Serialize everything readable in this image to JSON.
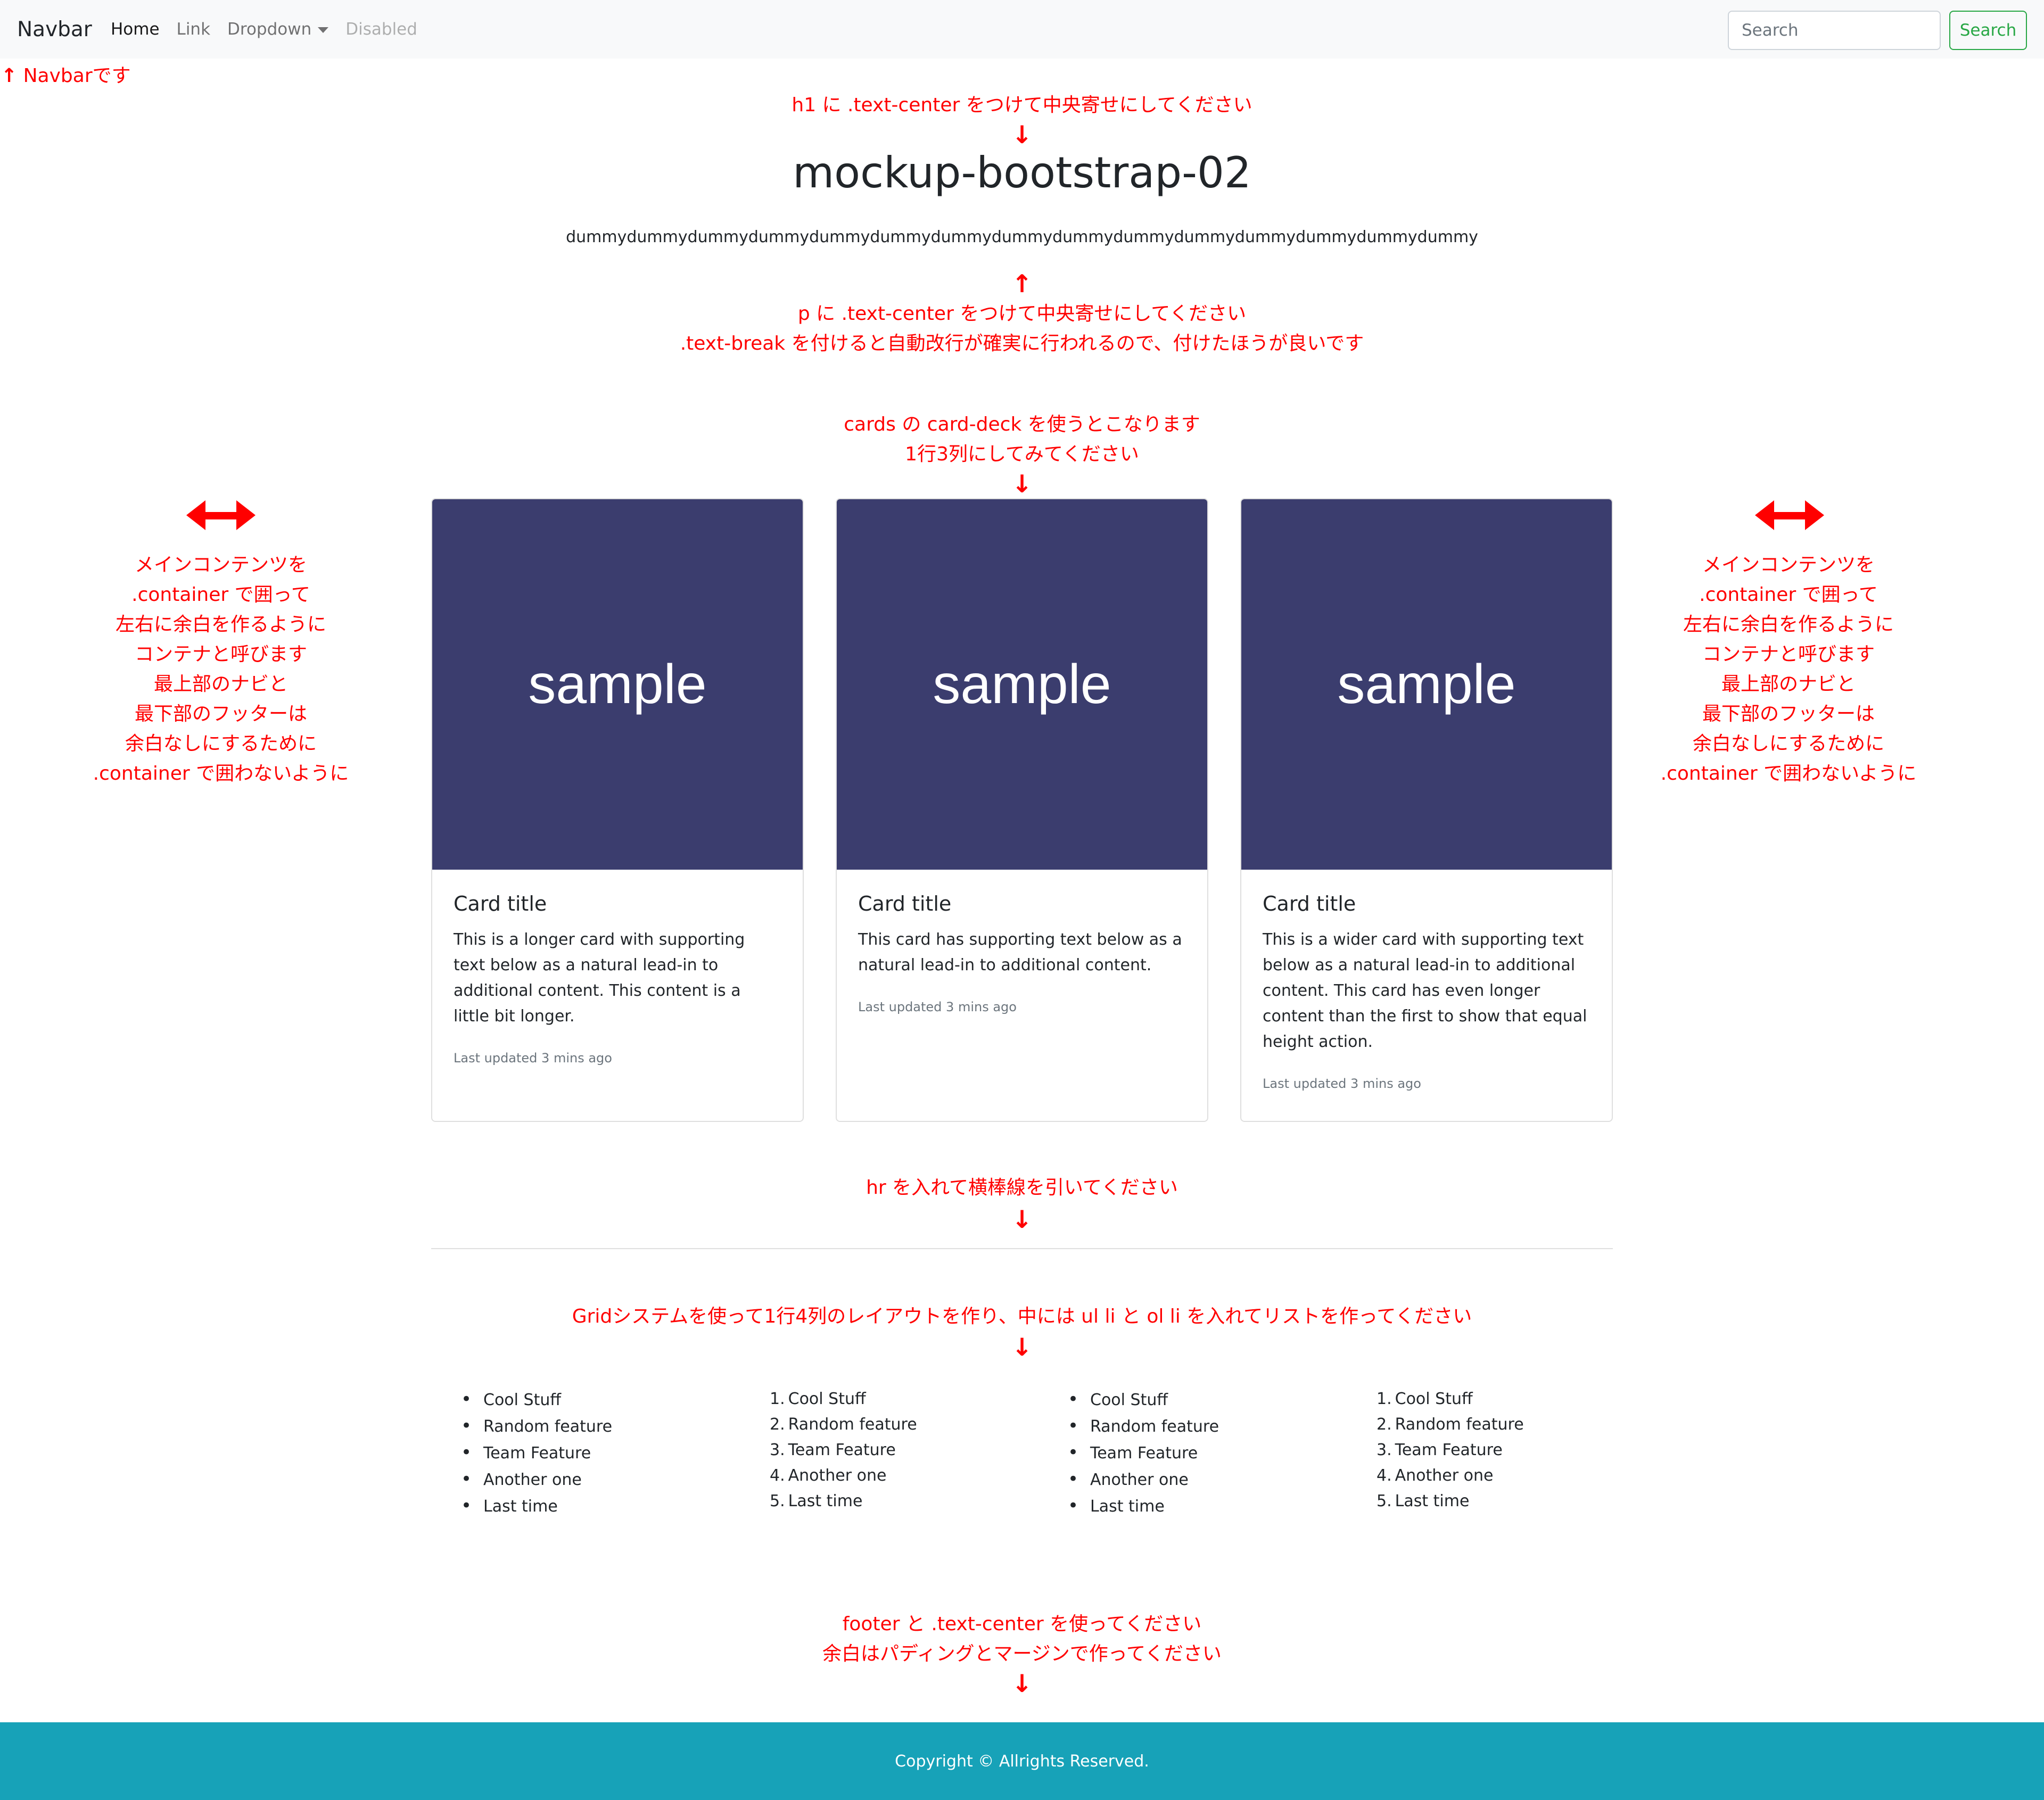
{
  "navbar": {
    "brand": "Navbar",
    "links": [
      {
        "label": "Home"
      },
      {
        "label": "Link"
      },
      {
        "label": "Dropdown"
      },
      {
        "label": "Disabled"
      }
    ],
    "search_placeholder": "Search",
    "search_button": "Search"
  },
  "annotations": {
    "navbar_note": "Navbarです",
    "h1_note": "h1 に .text-center をつけて中央寄せにしてください",
    "p_note_1": "p に .text-center をつけて中央寄せにしてください",
    "p_note_2": ".text-break を付けると自動改行が確実に行われるので、付けたほうが良いです",
    "cards_note_1": "cards の card-deck を使うとこなります",
    "cards_note_2": "1行3列にしてみてください",
    "container_note": [
      "メインコンテンツを",
      ".container で囲って",
      "左右に余白を作るように",
      "コンテナと呼びます",
      "最上部のナビと",
      "最下部のフッターは",
      "余白なしにするために",
      ".container で囲わないように"
    ],
    "hr_note": "hr を入れて横棒線を引いてください",
    "grid_note": "Gridシステムを使って1行4列のレイアウトを作り、中には ul li と ol li を入れてリストを作ってください",
    "footer_note_1": "footer と .text-center を使ってください",
    "footer_note_2": "余白はパディングとマージンで作ってください"
  },
  "main": {
    "title": "mockup-bootstrap-02",
    "dummy": "dummydummydummydummydummydummydummydummydummydummydummydummydummydummydummy"
  },
  "cards": [
    {
      "image_text": "sample",
      "title": "Card title",
      "text": "This is a longer card with supporting text below as a natural lead-in to additional content. This content is a little bit longer.",
      "updated": "Last updated 3 mins ago"
    },
    {
      "image_text": "sample",
      "title": "Card title",
      "text": "This card has supporting text below as a natural lead-in to additional content.",
      "updated": "Last updated 3 mins ago"
    },
    {
      "image_text": "sample",
      "title": "Card title",
      "text": "This is a wider card with supporting text below as a natural lead-in to additional content. This card has even longer content than the first to show that equal height action.",
      "updated": "Last updated 3 mins ago"
    }
  ],
  "list_items": [
    "Cool Stuff",
    "Random feature",
    "Team Feature",
    "Another one",
    "Last time"
  ],
  "list_numbers": [
    "1.",
    "2.",
    "3.",
    "4.",
    "5."
  ],
  "footer": {
    "text": "Copyright © Allrights Reserved."
  },
  "colors": {
    "annotation": "#ff0000",
    "card_image": "#3b3d6e",
    "footer": "#17a2b8",
    "search_button": "#28a745"
  }
}
